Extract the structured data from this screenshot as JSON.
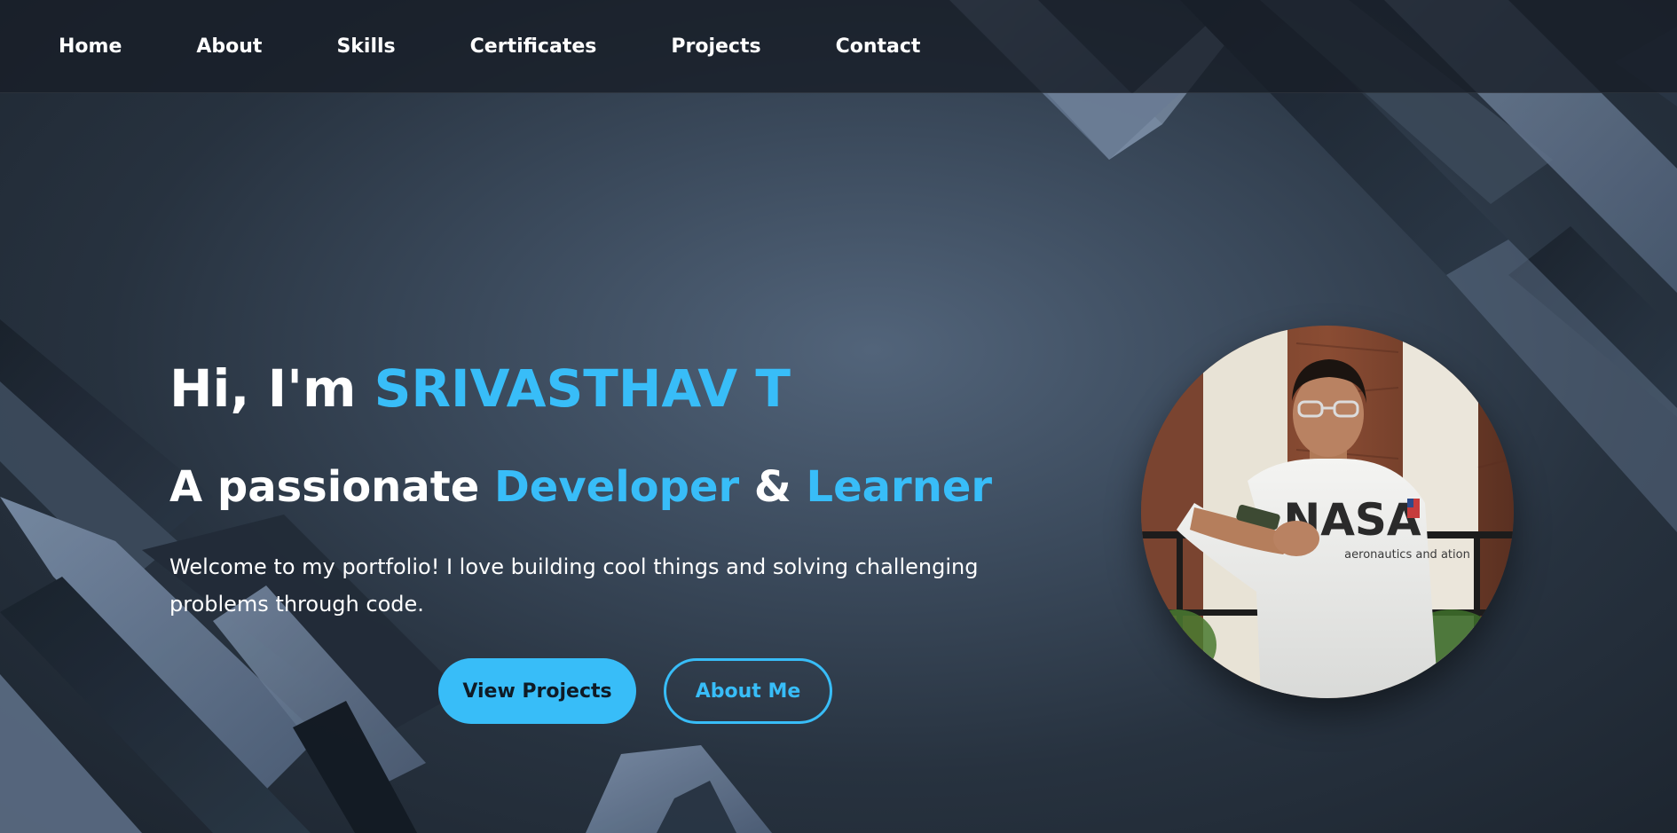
{
  "nav": {
    "items": [
      {
        "label": "Home"
      },
      {
        "label": "About"
      },
      {
        "label": "Skills"
      },
      {
        "label": "Certificates"
      },
      {
        "label": "Projects"
      },
      {
        "label": "Contact"
      }
    ]
  },
  "hero": {
    "greeting": "Hi, I'm ",
    "name": "SRIVASTHAV T",
    "subtitle_prefix": "A passionate ",
    "subtitle_role1": "Developer",
    "subtitle_amp": " & ",
    "subtitle_role2": "Learner",
    "description": "Welcome to my portfolio! I love building cool things and solving challenging problems through code."
  },
  "buttons": {
    "primary_label": "View Projects",
    "secondary_label": "About Me"
  },
  "avatar": {
    "shirt_text": "NASA",
    "shirt_subtext": "aeronautics and ation"
  },
  "colors": {
    "accent": "#38bdf8",
    "text": "#ffffff",
    "background": "#2a3645"
  }
}
